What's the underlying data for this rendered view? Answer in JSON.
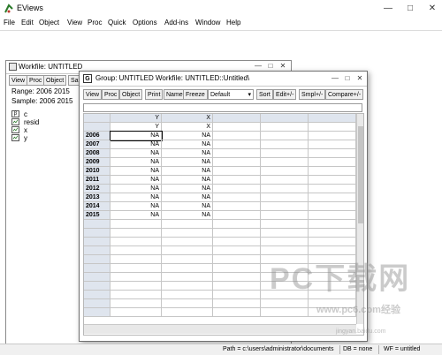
{
  "app": {
    "title": "EViews"
  },
  "menu": [
    "File",
    "Edit",
    "Object",
    "View",
    "Proc",
    "Quick",
    "Options",
    "Add-ins",
    "Window",
    "Help"
  ],
  "workfile_window": {
    "title": "Workfile: UNTITLED",
    "toolbar": [
      "View",
      "Proc",
      "Object",
      "Sa"
    ],
    "range_label": "Range:",
    "range_value": "2006 2015",
    "sample_label": "Sample:",
    "sample_value": "2006 2015",
    "objects": [
      {
        "name": "c",
        "icon": "coef-icon"
      },
      {
        "name": "resid",
        "icon": "series-icon"
      },
      {
        "name": "x",
        "icon": "series-icon"
      },
      {
        "name": "y",
        "icon": "series-icon"
      }
    ]
  },
  "group_window": {
    "title": "Group: UNTITLED   Workfile: UNTITLED::Untitled\\",
    "toolbar": [
      "View",
      "Proc",
      "Object",
      "Print",
      "Name",
      "Freeze"
    ],
    "view_select": "Default",
    "toolbar_right": [
      "Sort",
      "Edit+/-",
      "Smpl+/-",
      "Compare+/-"
    ],
    "edit_line": "",
    "columns": [
      "Y",
      "X"
    ],
    "column_subheaders": [
      "Y",
      "X"
    ],
    "rows": [
      {
        "obs": "2006",
        "values": [
          "NA",
          "NA"
        ]
      },
      {
        "obs": "2007",
        "values": [
          "NA",
          "NA"
        ]
      },
      {
        "obs": "2008",
        "values": [
          "NA",
          "NA"
        ]
      },
      {
        "obs": "2009",
        "values": [
          "NA",
          "NA"
        ]
      },
      {
        "obs": "2010",
        "values": [
          "NA",
          "NA"
        ]
      },
      {
        "obs": "2011",
        "values": [
          "NA",
          "NA"
        ]
      },
      {
        "obs": "2012",
        "values": [
          "NA",
          "NA"
        ]
      },
      {
        "obs": "2013",
        "values": [
          "NA",
          "NA"
        ]
      },
      {
        "obs": "2014",
        "values": [
          "NA",
          "NA"
        ]
      },
      {
        "obs": "2015",
        "values": [
          "NA",
          "NA"
        ]
      }
    ]
  },
  "statusbar": {
    "path": "Path = c:\\users\\administrator\\documents",
    "db": "DB = none",
    "wf": "WF = untitled"
  },
  "watermark": {
    "big": "PC下载网",
    "small": "www.pc6.com经验",
    "baidu": "jingyan.baidu.com"
  }
}
